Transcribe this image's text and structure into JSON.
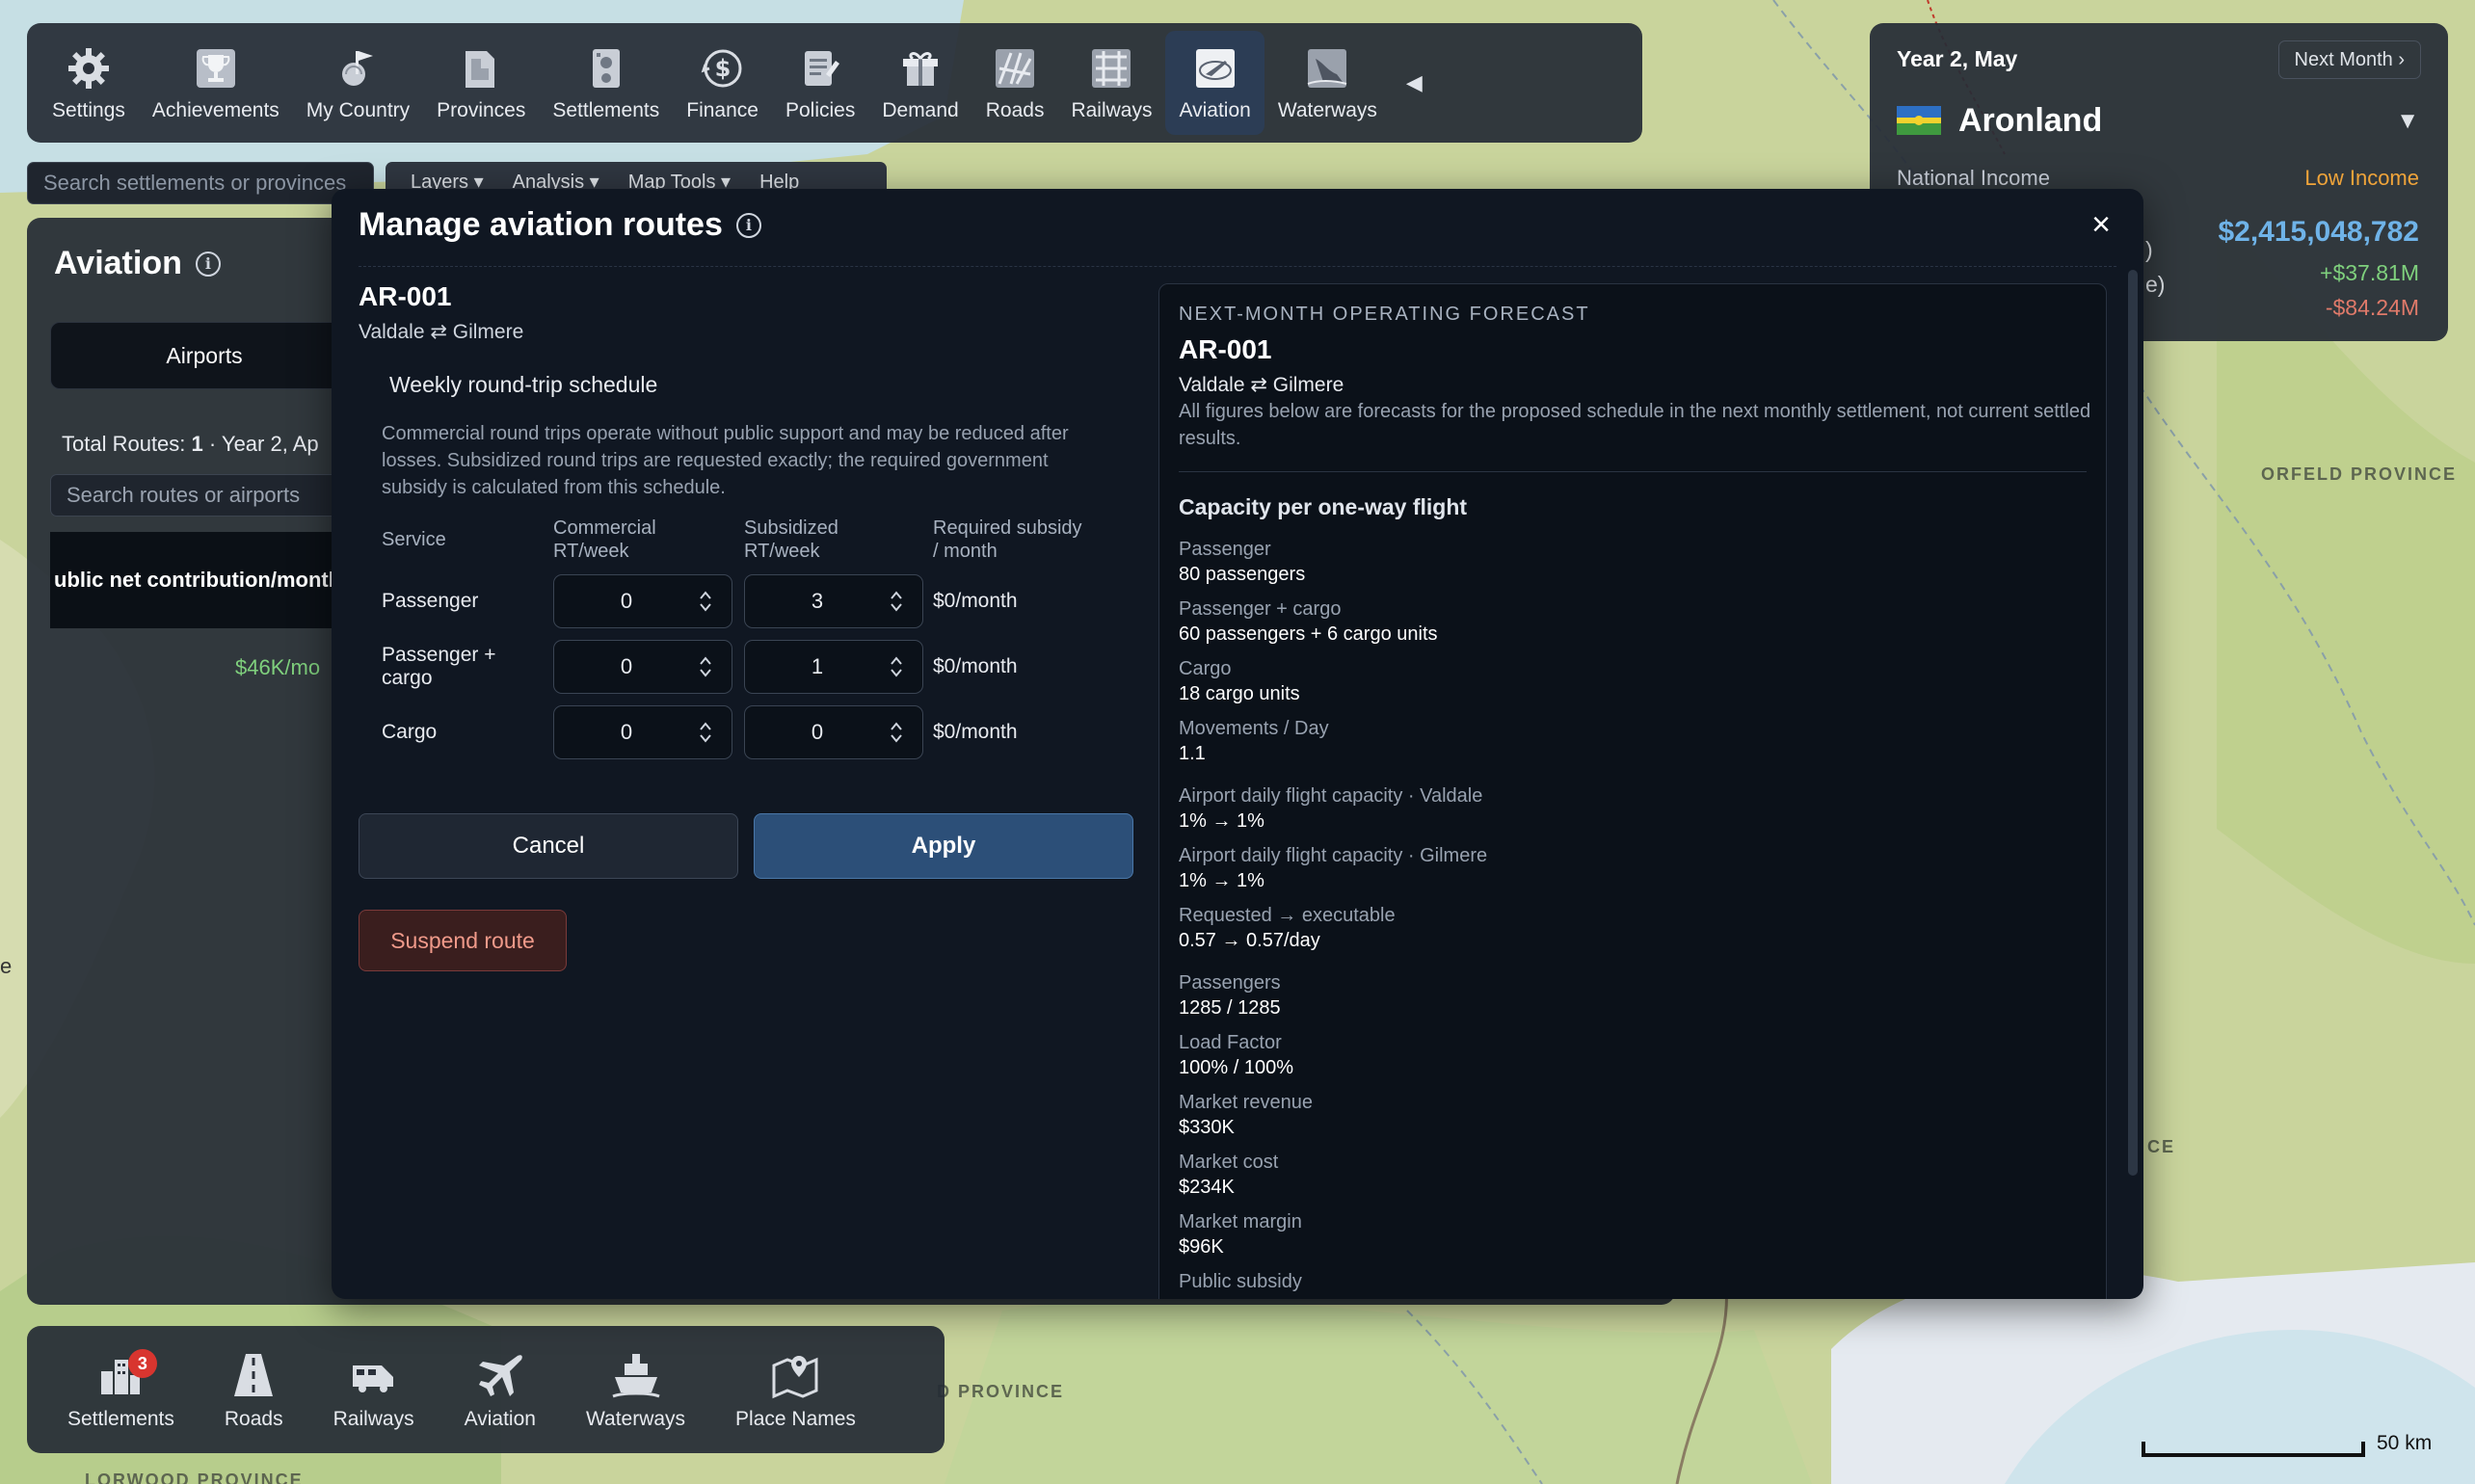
{
  "top_nav": {
    "items": [
      {
        "label": "Settings",
        "icon": "gear-icon"
      },
      {
        "label": "Achievements",
        "icon": "trophy-icon"
      },
      {
        "label": "My Country",
        "icon": "flag-icon"
      },
      {
        "label": "Provinces",
        "icon": "provinces-icon"
      },
      {
        "label": "Settlements",
        "icon": "settlements-icon"
      },
      {
        "label": "Finance",
        "icon": "finance-icon"
      },
      {
        "label": "Policies",
        "icon": "policies-icon"
      },
      {
        "label": "Demand",
        "icon": "demand-icon"
      },
      {
        "label": "Roads",
        "icon": "roads-icon"
      },
      {
        "label": "Railways",
        "icon": "railways-icon"
      },
      {
        "label": "Aviation",
        "icon": "aviation-icon",
        "active": true
      },
      {
        "label": "Waterways",
        "icon": "waterways-icon"
      }
    ],
    "collapse_glyph": "◀"
  },
  "global_search": {
    "placeholder": "Search settlements or provinces"
  },
  "map_toolbar": {
    "items": [
      "Layers ▾",
      "Analysis ▾",
      "Map Tools ▾",
      "Help"
    ]
  },
  "aviation_panel": {
    "title": "Aviation",
    "info_glyph": "i",
    "tab_airports": "Airports",
    "total_routes_prefix": "Total Routes: ",
    "total_routes_count": "1",
    "total_routes_suffix": " · Year 2, Ap",
    "route_search_placeholder": "Search routes or airports",
    "column_header": "ublic net contribution/month",
    "row_value": "$46K/mo"
  },
  "country_panel": {
    "date": "Year 2, May",
    "next_month": "Next Month ›",
    "country": "Aronland",
    "dropdown_glyph": "▼",
    "income_label": "National Income",
    "income_class": "Low Income",
    "income_value": "$2,415,048,782",
    "change_positive": "+$37.81M",
    "change_negative": "-$84.24M",
    "frag_1": ")",
    "frag_2": "e)"
  },
  "bottom_nav": {
    "items": [
      {
        "label": "Settlements",
        "icon": "settlements-icon",
        "badge": "3"
      },
      {
        "label": "Roads",
        "icon": "road-icon"
      },
      {
        "label": "Railways",
        "icon": "train-icon"
      },
      {
        "label": "Aviation",
        "icon": "airplane-icon"
      },
      {
        "label": "Waterways",
        "icon": "ship-icon"
      },
      {
        "label": "Place Names",
        "icon": "map-pin-icon"
      }
    ]
  },
  "map_labels": {
    "orfeld": "ORFELD PROVINCE",
    "province_partial": "D PROVINCE",
    "lorwood": "LORWOOD PROVINCE",
    "ce": "CE",
    "edge_e": "e",
    "scale": "50 km"
  },
  "modal": {
    "title": "Manage aviation routes",
    "info_glyph": "i",
    "close_glyph": "×",
    "route_id": "AR-001",
    "route_pair": "Valdale ⇄ Gilmere",
    "schedule_title": "Weekly round-trip schedule",
    "schedule_description": "Commercial round trips operate without public support and may be reduced after losses. Subsidized round trips are requested exactly; the required government subsidy is calculated from this schedule.",
    "columns": {
      "service": "Service",
      "commercial_1": "Commercial",
      "commercial_2": "RT/week",
      "subsidized_1": "Subsidized",
      "subsidized_2": "RT/week",
      "required_1": "Required subsidy",
      "required_2": "/ month"
    },
    "rows": [
      {
        "service": "Passenger",
        "commercial": "0",
        "subsidized": "3",
        "subsidy": "$0/month"
      },
      {
        "service_1": "Passenger +",
        "service_2": "cargo",
        "commercial": "0",
        "subsidized": "1",
        "subsidy": "$0/month"
      },
      {
        "service": "Cargo",
        "commercial": "0",
        "subsidized": "0",
        "subsidy": "$0/month"
      }
    ],
    "cancel_label": "Cancel",
    "apply_label": "Apply",
    "suspend_label": "Suspend route"
  },
  "forecast": {
    "kicker": "NEXT-MONTH OPERATING FORECAST",
    "route_id": "AR-001",
    "route_pair": "Valdale ⇄ Gilmere",
    "note": "All figures below are forecasts for the proposed schedule in the next monthly settlement, not current settled results.",
    "section_title": "Capacity per one-way flight",
    "metrics": [
      {
        "label": "Passenger",
        "value": "80 passengers"
      },
      {
        "label": "Passenger + cargo",
        "value": "60 passengers + 6 cargo units"
      },
      {
        "label": "Cargo",
        "value": "18 cargo units"
      },
      {
        "label": "Movements / Day",
        "value": "1.1"
      },
      {
        "label": "Airport daily flight capacity · Valdale",
        "value": "1% → 1%"
      },
      {
        "label": "Airport daily flight capacity · Gilmere",
        "value": "1% → 1%"
      },
      {
        "label": "Requested → executable",
        "value": "0.57 → 0.57/day"
      },
      {
        "label": "Passengers",
        "value": "1285 / 1285"
      },
      {
        "label": "Load Factor",
        "value": "100% / 100%"
      },
      {
        "label": "Market revenue",
        "value": "$330K"
      },
      {
        "label": "Market cost",
        "value": "$234K"
      },
      {
        "label": "Market margin",
        "value": "$96K"
      },
      {
        "label": "Public subsidy",
        "value": ""
      }
    ]
  },
  "colors": {
    "accent": "#2c4f78",
    "positive": "#7fd07d",
    "negative": "#e07a6a",
    "income": "#6fb3e8",
    "warning": "#f0a43a"
  }
}
